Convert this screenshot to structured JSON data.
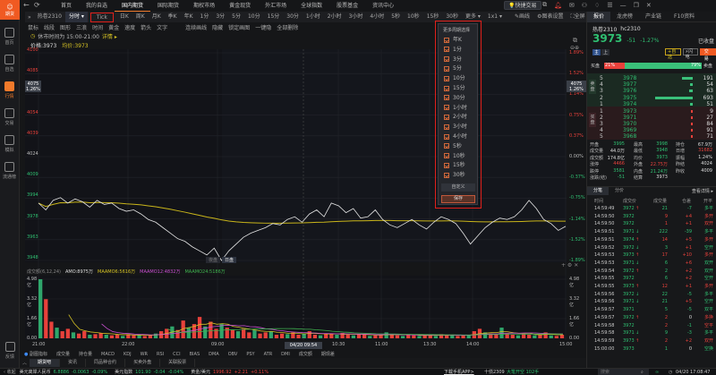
{
  "app": {
    "logo_text": "期货"
  },
  "nav": {
    "items": [
      "首页",
      "我的自选",
      "国内期货",
      "国际期货",
      "期权市场",
      "黄金现货",
      "外汇市场",
      "全球指数",
      "股票基金",
      "资讯中心"
    ],
    "active": 2
  },
  "window": {
    "quick_trade": "快捷交易"
  },
  "sidebar": {
    "items": [
      "首页",
      "自选",
      "行情",
      "交易",
      "模拟",
      "流通榜"
    ],
    "active": 2,
    "feedback": "反馈"
  },
  "periodbar": {
    "symbol": "热卷2310",
    "mode": "分时",
    "tick": "Tick",
    "periods": [
      "日K",
      "周K",
      "月K",
      "季K",
      "年K",
      "1分",
      "3分",
      "5分",
      "10分",
      "15分",
      "30分",
      "1小时",
      "2小时",
      "3小时",
      "4小时",
      "5秒",
      "10秒",
      "15秒",
      "30秒"
    ],
    "more": "更多",
    "layout": "1x1",
    "draw": "画线",
    "chart_settings": "图表设置",
    "fullscreen": "全屏",
    "hide": "隐藏"
  },
  "toolbar": {
    "tools": [
      "鼠标",
      "线段",
      "图形",
      "三浪",
      "时间",
      "黄金",
      "速度",
      "箭头",
      "文字"
    ],
    "right_tools": [
      "连续画线",
      "隐藏",
      "锁定画图",
      "一键隐",
      "全部删除"
    ]
  },
  "notice": {
    "text": "休市时间为 15:00-21:00",
    "link": "详情 ▸"
  },
  "chart": {
    "price_label": "价格:3973",
    "avg_label": "均价:3973",
    "y_labels": [
      "4100",
      "4085",
      "4070",
      "4054",
      "4039",
      "4024",
      "4009",
      "3994",
      "3978",
      "3963",
      "3948"
    ],
    "pct_labels": [
      "1.89%",
      "1.52%",
      "1.14%",
      "0.75%",
      "0.37%",
      "0.00%",
      "-0.37%",
      "-0.75%",
      "-1.14%",
      "-1.52%",
      "-1.89%"
    ],
    "cursor_price": "4075",
    "cursor_pct": "1.26%",
    "session_labels": [
      "夜盘",
      "日盘"
    ],
    "price": [
      3990,
      3985,
      3992,
      3994,
      3990,
      3993,
      3991,
      3987,
      3992,
      3989,
      3990,
      3986,
      3984,
      3985,
      3982,
      3978,
      3976,
      3972,
      3968,
      3964,
      3962,
      3958,
      3955,
      3952,
      3957,
      3948,
      3955,
      3960,
      3965,
      3968,
      3970,
      3972,
      3975,
      3974,
      3978,
      3980,
      3976,
      3982,
      3985,
      3980,
      3990,
      3988,
      3983,
      3986,
      3979,
      3980,
      3985,
      3978,
      3974,
      3972,
      3975,
      3978,
      3974,
      3971,
      3976,
      3980,
      3978,
      3975,
      3968,
      3960,
      3966,
      3972,
      3976,
      3979,
      3978,
      3980,
      3985,
      3992,
      3986,
      3978,
      3975,
      3970,
      3973
    ],
    "price_color": "#e6e6e6",
    "avg_color": "#c9b51a",
    "volume_legend": {
      "label": "成交额(6,12,24)",
      "amo": "AMO:8975万",
      "ma6": "MAAMO6:5616万",
      "ma12": "MAAMO12:4832万",
      "ma24": "MAAMO24:5186万"
    },
    "volume_labels": [
      "4.98亿",
      "3.32亿",
      "1.66亿",
      "0.00"
    ],
    "volume": [
      4.98,
      3.3,
      1.4,
      0.9,
      0.6,
      0.8,
      0.5,
      0.4,
      0.6,
      0.3,
      0.35,
      0.45,
      0.3,
      0.25,
      0.3,
      0.2,
      0.35,
      0.25,
      0.3,
      0.2,
      0.25,
      0.4,
      0.6,
      0.8,
      1.0,
      0.7,
      1.5,
      0.9,
      1.2,
      1.8,
      1.0,
      1.4,
      0.8,
      1.2,
      0.9,
      0.7,
      0.6,
      0.8,
      0.5,
      0.7,
      0.4,
      0.5,
      0.6,
      0.3,
      0.4,
      0.35,
      0.5,
      0.3,
      0.4,
      0.6,
      0.3,
      0.25,
      0.35,
      0.4,
      0.3,
      0.45,
      0.3,
      0.25,
      0.35,
      0.3,
      0.2,
      0.25,
      0.3,
      0.5,
      0.3,
      0.25,
      0.2,
      0.3,
      0.25,
      0.2,
      0.3,
      0.25,
      0.2,
      0.35,
      0.25,
      0.3,
      0.2,
      0.25,
      0.3,
      0.6,
      0.8,
      0.5,
      0.4,
      0.3,
      0.9,
      0.4,
      0.3,
      0.25,
      0.4,
      0.3,
      0.25,
      0.3,
      0.5,
      0.25,
      0.2,
      0.3
    ],
    "colors": {
      "up": "#e8413b",
      "down": "#2fa66b",
      "ma6": "#d6c324",
      "ma12": "#c84fd0",
      "ma24": "#3fb24f"
    },
    "x_labels": [
      "21:00",
      "22:00",
      "09:00",
      "10:30",
      "11:00",
      "13:30",
      "14:00",
      "15:00"
    ],
    "cursor_time": "04/20 09:54"
  },
  "dropdown": {
    "title": "更多周期选择",
    "items": [
      "年K",
      "1分",
      "3分",
      "5分",
      "10分",
      "15分",
      "30分",
      "1小时",
      "2小时",
      "3小时",
      "4小时",
      "5秒",
      "10秒",
      "15秒",
      "30秒"
    ],
    "custom": "自定义",
    "save": "保存"
  },
  "indicators": {
    "main": "副图指标",
    "items": [
      "成交量",
      "持仓量",
      "MACD",
      "KDJ",
      "WR",
      "RSI",
      "CCI",
      "BIAS",
      "DMA",
      "OBV",
      "PSY",
      "ATR",
      "DMI",
      "成交额",
      "期现差"
    ],
    "active": 13
  },
  "bottom_tabs": {
    "items": [
      "期货吧",
      "资讯",
      "同品种合约",
      "买卖外盘",
      "关联股票"
    ],
    "active": 0
  },
  "status": {
    "items": [
      {
        "name": "美元离岸人民币",
        "value": "6.8886",
        "chg": "-0.0063",
        "pct": "-0.09%",
        "dir": "down"
      },
      {
        "name": "美元指数",
        "value": "101.90",
        "chg": "-0.04",
        "pct": "-0.04%",
        "dir": "down"
      },
      {
        "name": "黄金/美元",
        "value": "1996.92",
        "chg": "+2.21",
        "pct": "+0.11%",
        "dir": "up"
      }
    ],
    "collapse": "收起",
    "download": "下载手机APP>",
    "ticker": "十债2309",
    "ticker_text": "大笔开空 102手",
    "search_placeholder": "搜索",
    "time": "04/20 17:08:47"
  },
  "quote": {
    "tabs": [
      "报价",
      "龙虎榜",
      "产业链",
      "F10资料"
    ],
    "name": "热卷2310",
    "code": "hc2310",
    "price": "3973",
    "change": "-51",
    "pct": "-1.27%",
    "state": "已收盘",
    "btn_main": "主",
    "btn_up": "上",
    "add_fav": "+自选",
    "flash": "闪电",
    "trade": "交易",
    "buy_label": "买盘",
    "sell_label": "卖盘",
    "buy_pct": "21%",
    "sell_pct": "79%",
    "buy_ratio": 0.21,
    "ask_label": "卖盘",
    "bid_label": "买盘",
    "asks": [
      {
        "lvl": "5",
        "price": "3978",
        "vol": "191"
      },
      {
        "lvl": "4",
        "price": "3977",
        "vol": "54"
      },
      {
        "lvl": "3",
        "price": "3976",
        "vol": "63"
      },
      {
        "lvl": "2",
        "price": "3975",
        "vol": "693"
      },
      {
        "lvl": "1",
        "price": "3974",
        "vol": "51"
      }
    ],
    "bids": [
      {
        "lvl": "1",
        "price": "3973",
        "vol": "9"
      },
      {
        "lvl": "2",
        "price": "3971",
        "vol": "27"
      },
      {
        "lvl": "3",
        "price": "3970",
        "vol": "84"
      },
      {
        "lvl": "4",
        "price": "3969",
        "vol": "91"
      },
      {
        "lvl": "5",
        "price": "3968",
        "vol": "71"
      }
    ],
    "stats": [
      [
        {
          "k": "开盘",
          "v": "3995",
          "c": "green"
        },
        {
          "k": "最高",
          "v": "3998",
          "c": "green"
        },
        {
          "k": "持仓",
          "v": "67.9万",
          "c": "white"
        }
      ],
      [
        {
          "k": "成交量",
          "v": "44.0万",
          "c": "white"
        },
        {
          "k": "最低",
          "v": "3948",
          "c": "green"
        },
        {
          "k": "日增",
          "v": "31682",
          "c": "red"
        }
      ],
      [
        {
          "k": "成交额",
          "v": "174.8亿",
          "c": "white"
        },
        {
          "k": "均价",
          "v": "3973",
          "c": "green"
        },
        {
          "k": "振幅",
          "v": "1.24%",
          "c": "white"
        }
      ],
      [
        {
          "k": "涨停",
          "v": "4466",
          "c": "red"
        },
        {
          "k": "外盘",
          "v": "22.75万",
          "c": "red"
        },
        {
          "k": "昨结",
          "v": "4024",
          "c": "white"
        }
      ],
      [
        {
          "k": "跌停",
          "v": "3581",
          "c": "green"
        },
        {
          "k": "内盘",
          "v": "21.24万",
          "c": "green"
        },
        {
          "k": "昨收",
          "v": "4009",
          "c": "white"
        }
      ],
      [
        {
          "k": "涨跌(结)",
          "v": "-51",
          "c": "green"
        },
        {
          "k": "结算",
          "v": "3973",
          "c": "white"
        }
      ]
    ],
    "trade_tabs": [
      "分笔",
      "分价"
    ],
    "detail_link": "查看详情 ▸",
    "trade_headers": [
      "时间",
      "成交价",
      "成交量",
      "仓差",
      "开平"
    ],
    "trades": [
      {
        "t": "14:59:49",
        "p": "3972",
        "a": "↑",
        "v": "21",
        "d": "-7",
        "o": "多平",
        "c": "g"
      },
      {
        "t": "14:59:50",
        "p": "3972",
        "a": "",
        "v": "9",
        "d": "+4",
        "o": "多开",
        "c": "r"
      },
      {
        "t": "14:59:50",
        "p": "3972",
        "a": "",
        "v": "1",
        "d": "+1",
        "o": "双开",
        "c": "r"
      },
      {
        "t": "14:59:51",
        "p": "3971",
        "a": "↓",
        "v": "222",
        "d": "-39",
        "o": "多平",
        "c": "g"
      },
      {
        "t": "14:59:51",
        "p": "3974",
        "a": "↑",
        "v": "14",
        "d": "+5",
        "o": "多开",
        "c": "r"
      },
      {
        "t": "14:59:52",
        "p": "3972",
        "a": "↓",
        "v": "3",
        "d": "+1",
        "o": "空开",
        "c": "g"
      },
      {
        "t": "14:59:53",
        "p": "3973",
        "a": "↑",
        "v": "17",
        "d": "+10",
        "o": "多开",
        "c": "r"
      },
      {
        "t": "14:59:53",
        "p": "3971",
        "a": "↓",
        "v": "6",
        "d": "+6",
        "o": "双开",
        "c": "g"
      },
      {
        "t": "14:59:54",
        "p": "3972",
        "a": "↑",
        "v": "2",
        "d": "+2",
        "o": "双开",
        "c": "g"
      },
      {
        "t": "14:59:55",
        "p": "3972",
        "a": "",
        "v": "6",
        "d": "+2",
        "o": "空开",
        "c": "g"
      },
      {
        "t": "14:59:55",
        "p": "3973",
        "a": "↑",
        "v": "12",
        "d": "+1",
        "o": "多开",
        "c": "r"
      },
      {
        "t": "14:59:56",
        "p": "3972",
        "a": "↓",
        "v": "22",
        "d": "-5",
        "o": "多平",
        "c": "g"
      },
      {
        "t": "14:59:56",
        "p": "3971",
        "a": "↓",
        "v": "21",
        "d": "+5",
        "o": "空开",
        "c": "g"
      },
      {
        "t": "14:59:57",
        "p": "3971",
        "a": "",
        "v": "5",
        "d": "-5",
        "o": "双平",
        "c": "g"
      },
      {
        "t": "14:59:57",
        "p": "3972",
        "a": "↑",
        "v": "2",
        "d": "0",
        "o": "多换",
        "c": "r"
      },
      {
        "t": "14:59:58",
        "p": "3972",
        "a": "",
        "v": "2",
        "d": "-1",
        "o": "空平",
        "c": "r"
      },
      {
        "t": "14:59:58",
        "p": "3971",
        "a": "↓",
        "v": "9",
        "d": "-3",
        "o": "多平",
        "c": "g"
      },
      {
        "t": "14:59:59",
        "p": "3973",
        "a": "↑",
        "v": "2",
        "d": "+2",
        "o": "双开",
        "c": "r"
      },
      {
        "t": "15:00:00",
        "p": "3973",
        "a": "",
        "v": "1",
        "d": "0",
        "o": "空换",
        "c": "g"
      }
    ]
  }
}
